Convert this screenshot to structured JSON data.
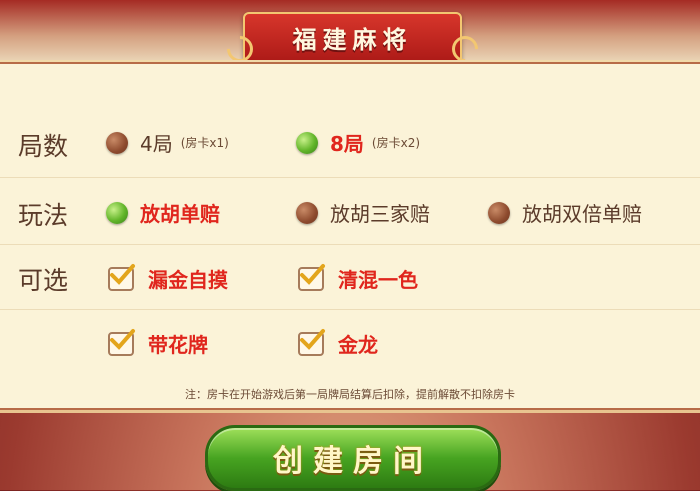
{
  "title": "福建麻将",
  "rows": [
    {
      "label": "局数",
      "options": [
        {
          "text": "4局",
          "sub": "(房卡x1)",
          "selected": false
        },
        {
          "text": "8局",
          "sub": "(房卡x2)",
          "selected": true
        }
      ]
    },
    {
      "label": "玩法",
      "options": [
        {
          "text": "放胡单赔",
          "selected": true
        },
        {
          "text": "放胡三家赔",
          "selected": false
        },
        {
          "text": "放胡双倍单赔",
          "selected": false
        }
      ]
    },
    {
      "label": "可选",
      "options": [
        {
          "text": "漏金自摸",
          "checked": true
        },
        {
          "text": "清混一色",
          "checked": true
        }
      ]
    },
    {
      "label": "",
      "options": [
        {
          "text": "带花牌",
          "checked": true
        },
        {
          "text": "金龙",
          "checked": true
        }
      ]
    }
  ],
  "note": "注：房卡在开始游戏后第一局牌局结算后扣除，提前解散不扣除房卡",
  "create_button": "创建房间",
  "colors": {
    "selected_text": "#e0261d",
    "radio_on": "#62b529",
    "radio_off": "#8d4a2d",
    "button": "#47a421"
  }
}
